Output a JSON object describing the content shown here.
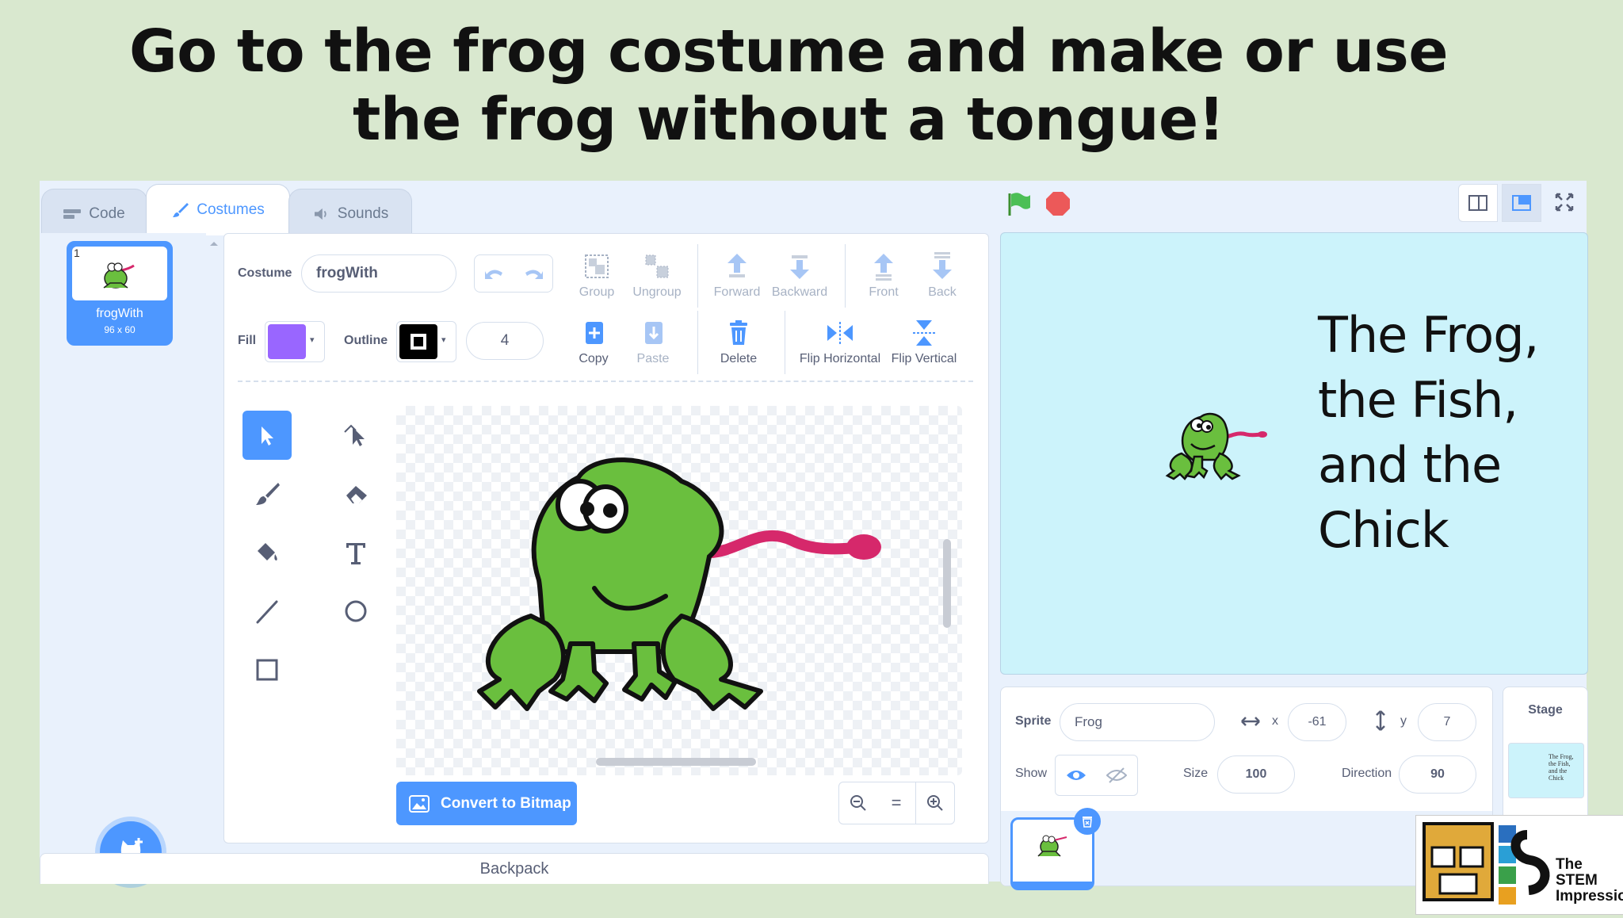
{
  "headline": "Go to the frog costume and make or use the frog without a tongue!",
  "tabs": {
    "code": "Code",
    "costumes": "Costumes",
    "sounds": "Sounds"
  },
  "costume_list": {
    "number": "1",
    "name": "frogWith",
    "dims": "96 x 60"
  },
  "paint": {
    "costume_label": "Costume",
    "costume_name": "frogWith",
    "fill_label": "Fill",
    "fill_color": "#9966ff",
    "outline_label": "Outline",
    "outline_color": "#000000",
    "outline_width": "4",
    "buttons": {
      "group": "Group",
      "ungroup": "Ungroup",
      "forward": "Forward",
      "backward": "Backward",
      "front": "Front",
      "back": "Back",
      "copy": "Copy",
      "paste": "Paste",
      "delete": "Delete",
      "flip_h": "Flip Horizontal",
      "flip_v": "Flip Vertical"
    },
    "convert": "Convert to Bitmap",
    "zoom_reset": "="
  },
  "backpack": "Backpack",
  "stage": {
    "title": "The Frog,\nthe Fish,\nand the\nChick"
  },
  "sprite_info": {
    "sprite_label": "Sprite",
    "sprite_name": "Frog",
    "x_label": "x",
    "x": "-61",
    "y_label": "y",
    "y": "7",
    "show_label": "Show",
    "size_label": "Size",
    "size": "100",
    "direction_label": "Direction",
    "direction": "90"
  },
  "stage_panel": {
    "label": "Stage",
    "thumb_text": "The Frog, the Fish, and the Chick"
  },
  "logo": {
    "text": "The STEM Impressionists"
  },
  "colors": {
    "accent": "#4d97ff",
    "tongue": "#d6286b",
    "frog": "#6abf3e",
    "stage_bg": "#ccf3fb"
  }
}
